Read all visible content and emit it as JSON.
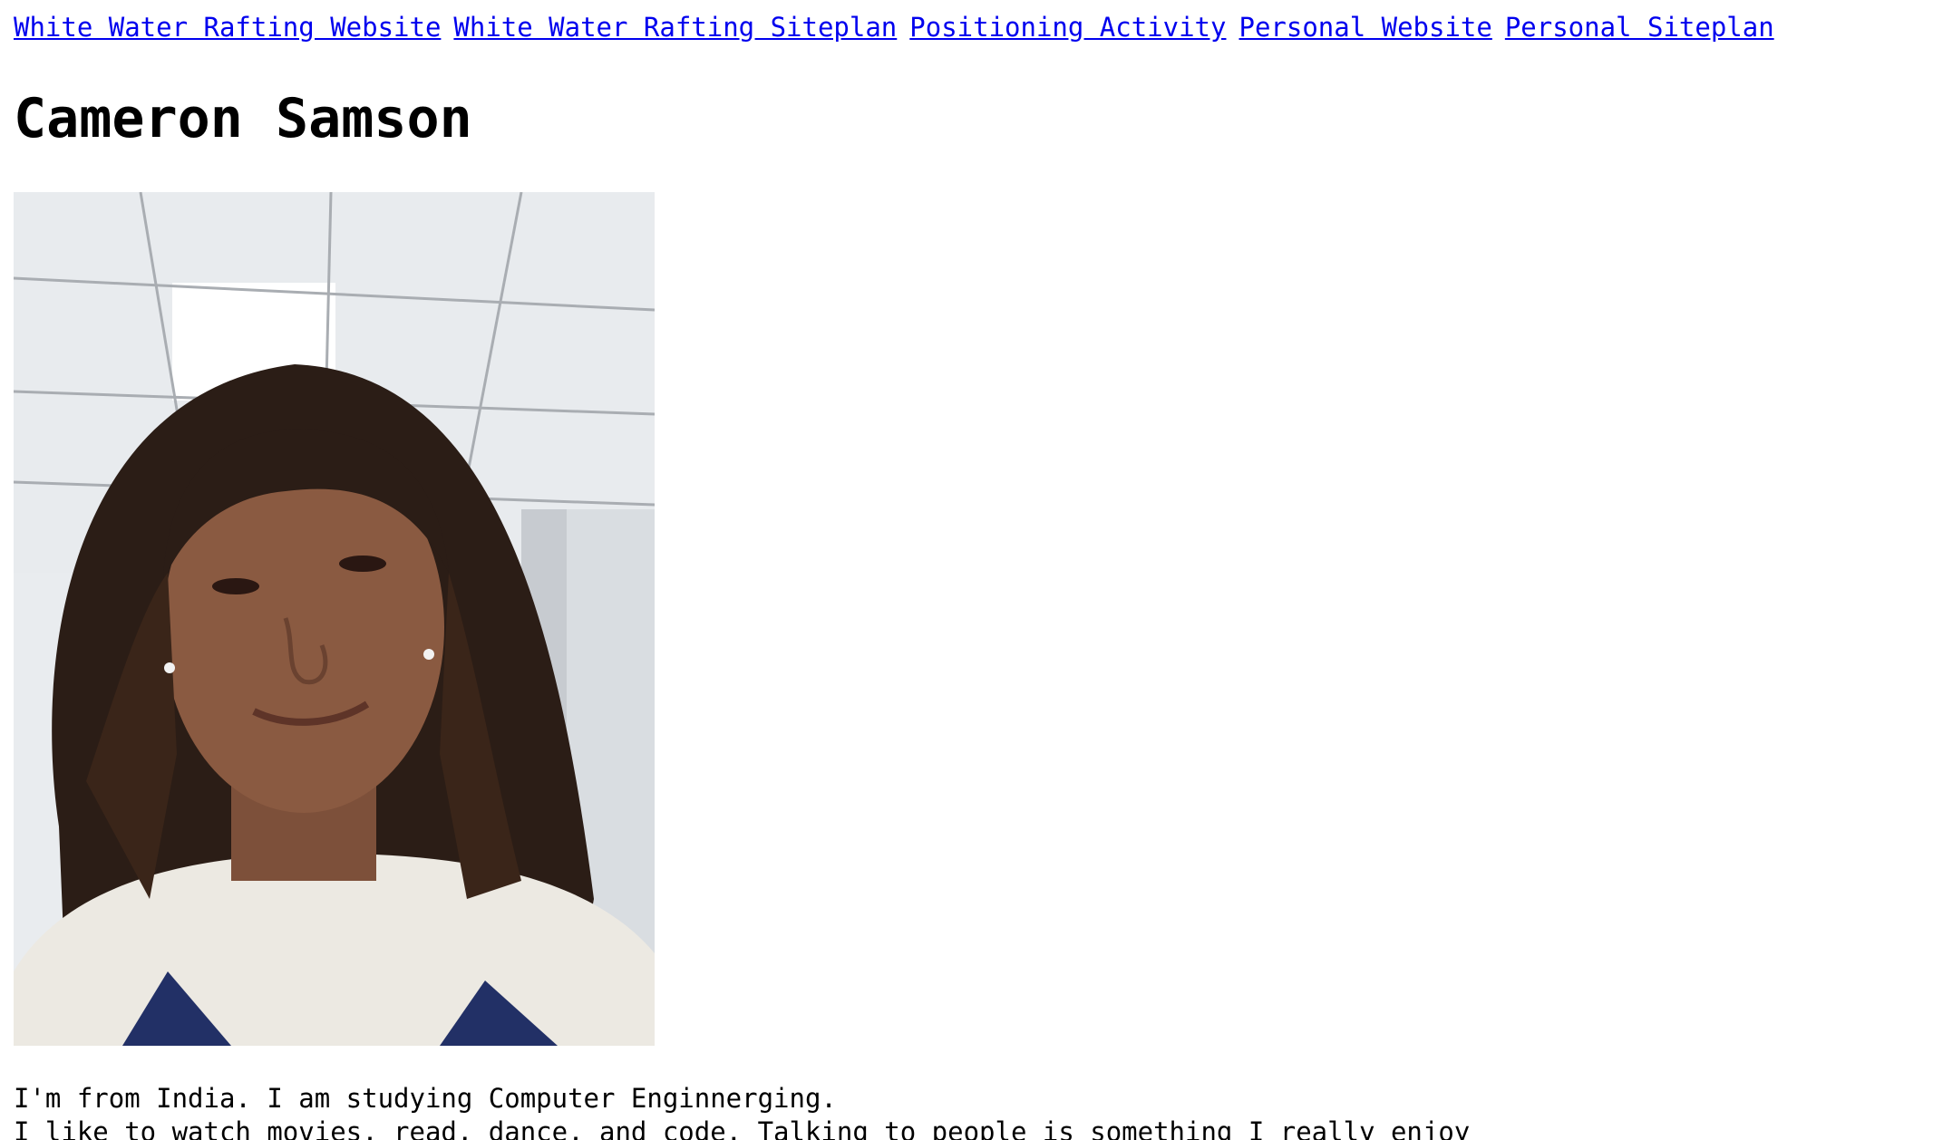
{
  "nav": {
    "links": [
      "White Water Rafting Website",
      "White Water Rafting Siteplan",
      "Positioning Activity",
      "Personal Website",
      "Personal Siteplan"
    ]
  },
  "page": {
    "title": "Cameron Samson",
    "bio_line_1": "I'm from India. I am studying Computer Enginnerging.",
    "bio_line_2": "I like to watch movies, read, dance, and code. Talking to people is something I really enjoy"
  },
  "photo": {
    "kind": "profile-photo",
    "colors": {
      "ceiling": "#e8ebee",
      "ceiling_grid": "#a9adb2",
      "hair": "#2b1d16",
      "skin": "#8a5a41",
      "sweater": "#ece9e2",
      "letters": "#223066"
    }
  }
}
